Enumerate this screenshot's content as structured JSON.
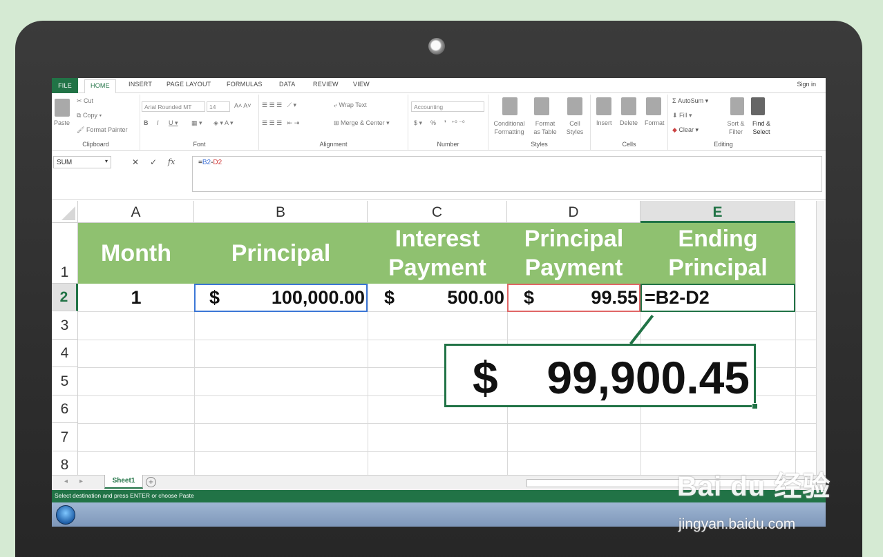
{
  "ribbon": {
    "tabs": [
      "FILE",
      "HOME",
      "INSERT",
      "PAGE LAYOUT",
      "FORMULAS",
      "DATA",
      "REVIEW",
      "VIEW"
    ],
    "sign_in": "Sign in",
    "clipboard": {
      "cut": "Cut",
      "copy": "Copy",
      "paste": "Paste",
      "format_painter": "Format Painter",
      "label": "Clipboard"
    },
    "font": {
      "name": "Arial Rounded MT",
      "size": "14",
      "label": "Font"
    },
    "alignment": {
      "wrap_text": "Wrap Text",
      "merge_center": "Merge & Center",
      "label": "Alignment"
    },
    "number": {
      "format": "Accounting",
      "currency": "$",
      "percent": "%",
      "label": "Number"
    },
    "styles": {
      "conditional_formatting": "Conditional Formatting",
      "format_as_table": "Format as Table",
      "cell_styles": "Cell Styles",
      "label": "Styles"
    },
    "cells": {
      "insert": "Insert",
      "delete": "Delete",
      "format": "Format",
      "label": "Cells"
    },
    "editing": {
      "autosum": "AutoSum",
      "fill": "Fill",
      "clear": "Clear",
      "sort_filter": "Sort & Filter",
      "find_select": "Find & Select",
      "label": "Editing"
    }
  },
  "formula_bar": {
    "name_box": "SUM",
    "fx": "fx",
    "formula_prefix": "=",
    "formula_ref1": "B2",
    "formula_op": "-",
    "formula_ref2": "D2"
  },
  "grid": {
    "columns": [
      "A",
      "B",
      "C",
      "D",
      "E"
    ],
    "rows": [
      "1",
      "2",
      "3",
      "4",
      "5",
      "6",
      "7",
      "8"
    ],
    "headers": {
      "month": "Month",
      "principal": "Principal",
      "interest_1": "Interest",
      "interest_2": "Payment",
      "ppay_1": "Principal",
      "ppay_2": "Payment",
      "end_1": "Ending",
      "end_2": "Principal"
    },
    "row2": {
      "month": "1",
      "principal_cur": "$",
      "principal": "100,000.00",
      "interest_cur": "$",
      "interest": "500.00",
      "ppay_cur": "$",
      "ppay": "99.55",
      "ending_formula": "=B2-D2"
    },
    "callout": {
      "currency": "$",
      "value": "99,900.45"
    }
  },
  "sheet_tabs": {
    "active": "Sheet1",
    "add": "+"
  },
  "status_bar": {
    "message": "Select destination and press ENTER or choose Paste"
  },
  "watermark": {
    "brand": "Bai du 经验",
    "url": "jingyan.baidu.com"
  },
  "colors": {
    "excel_green": "#217346",
    "header_fill": "#8fc170",
    "background": "#d5ead3"
  }
}
